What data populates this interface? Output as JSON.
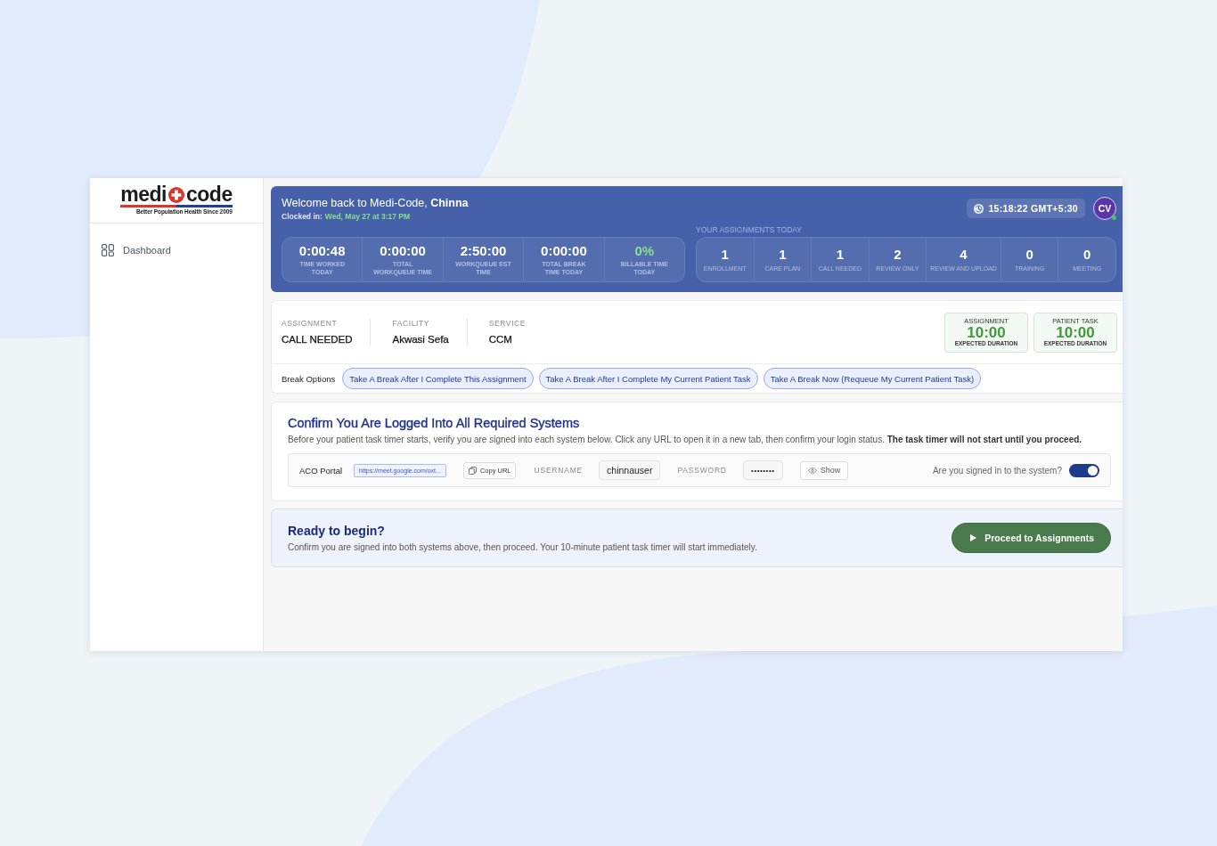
{
  "sidebar": {
    "logo": {
      "word_left": "medi",
      "word_right": "code",
      "tagline": "Better Population Health Since 2009"
    },
    "items": [
      {
        "label": "Dashboard",
        "selected": false
      }
    ]
  },
  "header": {
    "greeting": "Welcome back to Medi-Code, **Chinna**",
    "clocked_in_label": "Clocked in:",
    "clocked_in_value": "Wed, May 27 at 3:17 PM",
    "clock": "15:18:22 GMT+5:30",
    "avatar": {
      "initials": "CV",
      "online": true
    },
    "stats": [
      {
        "value": "0:00:48",
        "label": "TIME WORKED TODAY",
        "color": "#ffffff"
      },
      {
        "value": "0:00:00",
        "label": "TOTAL WORKQUEUE TIME",
        "color": "#ffffff"
      },
      {
        "value": "2:50:00",
        "label": "WORKQUEUE EST TIME",
        "color": "#ffffff"
      },
      {
        "value": "0:00:00",
        "label": "TOTAL BREAK TIME TODAY",
        "color": "#ffffff"
      },
      {
        "value": "0%",
        "label": "BILLABLE TIME TODAY",
        "color": "#86e08f"
      }
    ],
    "assignments_title": "YOUR ASSIGNMENTS TODAY",
    "assignments": [
      {
        "count": "1",
        "label": "ENROLLMENT"
      },
      {
        "count": "1",
        "label": "CARE PLAN"
      },
      {
        "count": "1",
        "label": "CALL NEEDED"
      },
      {
        "count": "2",
        "label": "REVIEW ONLY"
      },
      {
        "count": "4",
        "label": "REVIEW AND UPLOAD"
      },
      {
        "count": "0",
        "label": "TRAINING"
      },
      {
        "count": "0",
        "label": "MEETING"
      }
    ]
  },
  "assignment": {
    "fields": [
      {
        "label": "ASSIGNMENT",
        "value": "CALL NEEDED"
      },
      {
        "label": "FACILITY",
        "value": "Akwasi Sefa"
      },
      {
        "label": "SERVICE",
        "value": "CCM"
      }
    ],
    "durations": [
      {
        "title": "ASSIGNMENT",
        "value": "10:00",
        "caption": "EXPECTED DURATION"
      },
      {
        "title": "PATIENT TASK",
        "value": "10:00",
        "caption": "EXPECTED DURATION"
      }
    ]
  },
  "break_options": {
    "label": "Break Options",
    "buttons": [
      "Take A Break After I Complete This Assignment",
      "Take A Break After I Complete My Current Patient Task",
      "Take A Break Now (Requeue My Current Patient Task)"
    ]
  },
  "login_check": {
    "title": "Confirm You Are Logged Into All Required Systems",
    "description": "Before your patient task timer starts, verify you are signed into each system below. Click any URL to open it in a new tab, then confirm your login status. **The task timer will not start until you proceed.**",
    "systems": [
      {
        "name": "ACO Portal",
        "url": "https://meet.google.com/oxt...",
        "copy_label": "Copy URL",
        "username_label": "USERNAME",
        "username": "chinnauser",
        "password_label": "PASSWORD",
        "password": "••••••••",
        "show_label": "Show",
        "question": "Are you signed in to the system?",
        "signed_in": true
      }
    ]
  },
  "ready": {
    "title": "Ready to begin?",
    "description": "Confirm you are signed into both systems above, then proceed. Your 10-minute patient task timer will start immediately.",
    "button": "Proceed to Assignments"
  }
}
